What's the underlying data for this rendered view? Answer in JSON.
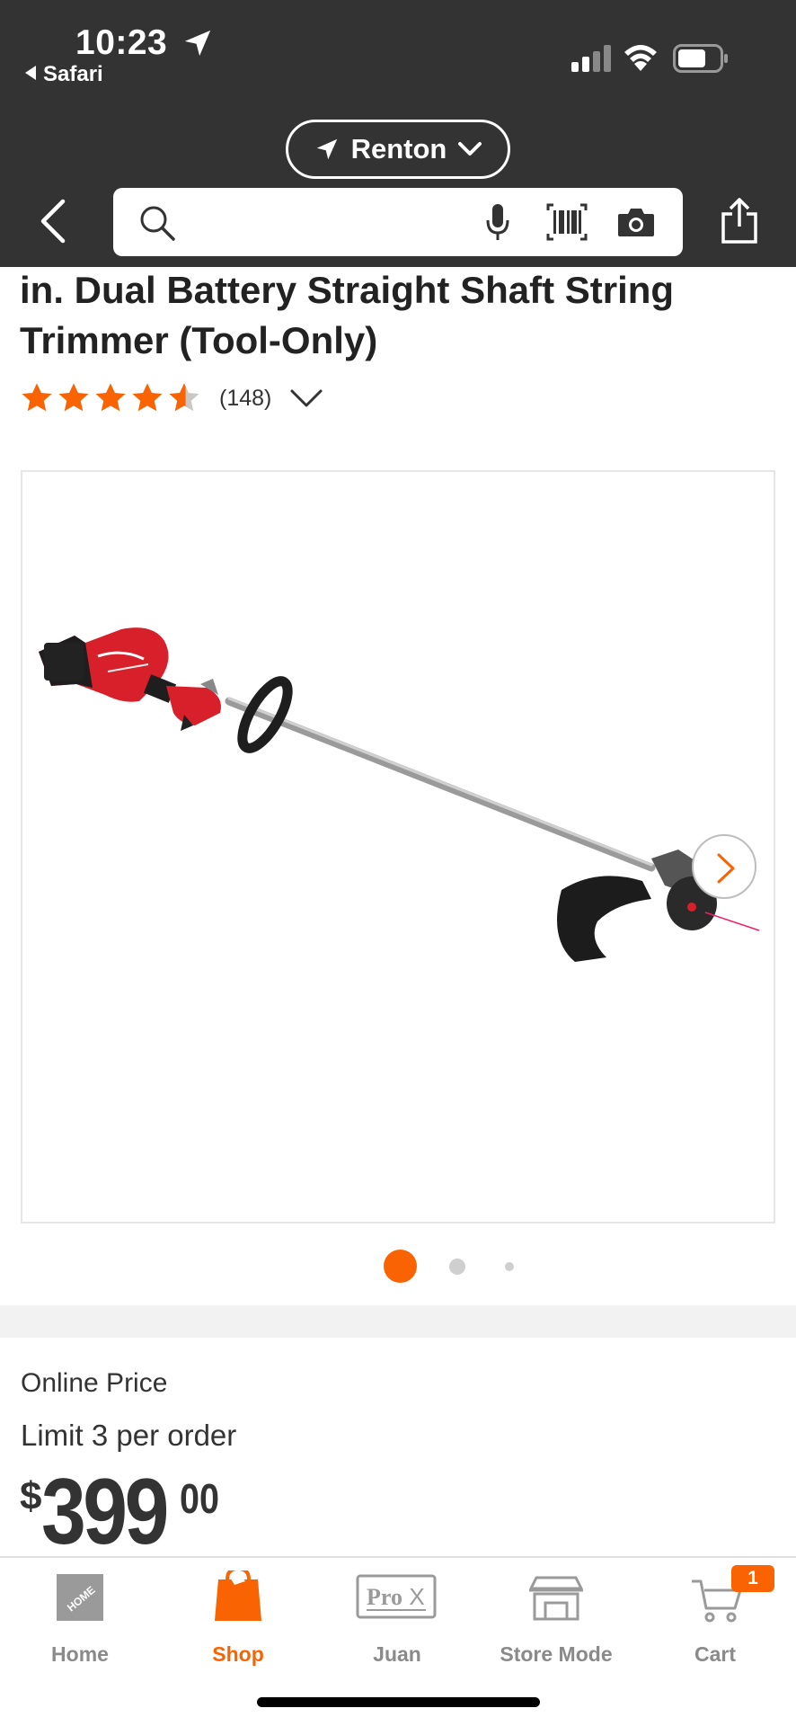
{
  "status_bar": {
    "time": "10:23",
    "back_app": "Safari"
  },
  "header": {
    "location": "Renton",
    "search_placeholder": "",
    "accent_color": "#f96302",
    "header_color": "#333333"
  },
  "product": {
    "title": "in. Dual Battery Straight Shaft String Trimmer (Tool-Only)",
    "rating_value": 4.5,
    "review_count": "(148)",
    "image_index": 1,
    "image_count": 3
  },
  "pricing": {
    "online_price_label": "Online Price",
    "limit_text": "Limit 3 per order",
    "currency": "$",
    "dollars": "399",
    "cents": "00"
  },
  "tabs": [
    {
      "label": "Home",
      "icon": "home-depot-logo-icon",
      "active": false
    },
    {
      "label": "Shop",
      "icon": "shopping-bag-icon",
      "active": true
    },
    {
      "label": "Juan",
      "icon": "prox-icon",
      "active": false
    },
    {
      "label": "Store Mode",
      "icon": "store-icon",
      "active": false
    },
    {
      "label": "Cart",
      "icon": "cart-icon",
      "active": false,
      "badge": "1"
    }
  ],
  "icons": [
    "location-arrow-icon",
    "chevron-down-icon",
    "back-chevron-icon",
    "search-icon",
    "microphone-icon",
    "barcode-icon",
    "camera-icon",
    "share-icon",
    "star-icon",
    "chevron-right-icon"
  ]
}
